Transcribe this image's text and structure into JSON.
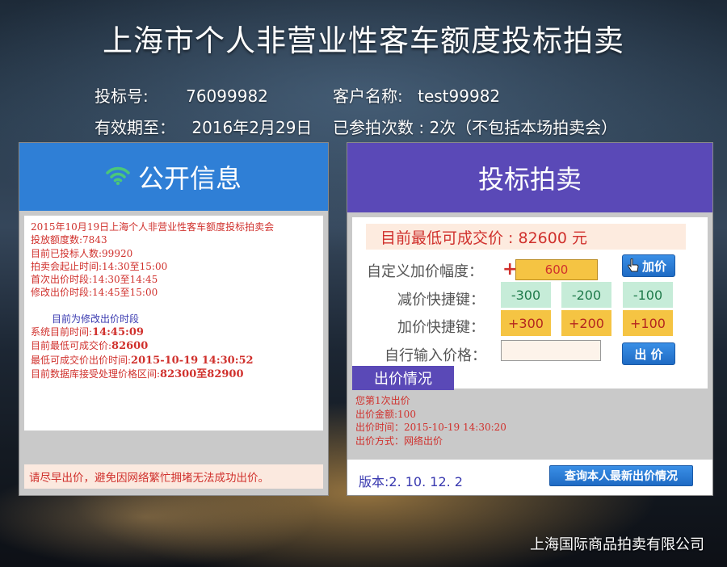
{
  "page": {
    "title": "上海市个人非营业性客车额度投标拍卖",
    "company": "上海国际商品拍卖有限公司"
  },
  "user_info": {
    "bid_no_label": "投标号:",
    "bid_no": "76099982",
    "customer_label": "客户名称:",
    "customer": "test99982",
    "valid_label": "有效期至：",
    "valid_until": "2016年2月29日",
    "attended_label": "已参拍次数 : 2次（不包括本场拍卖会）"
  },
  "public_info": {
    "header": "公开信息",
    "lines": [
      "2015年10月19日上海个人非营业性客车额度投标拍卖会",
      "投放额度数:7843",
      "目前已投标人数:99920",
      "拍卖会起止时间:14:30至15:00",
      "首次出价时段:14:30至14:45",
      "修改出价时段:14:45至15:00"
    ],
    "phase": "目前为修改出价时段",
    "system_time_label": "系统目前时间:",
    "system_time": "14:45:09",
    "lowest_price_label": "目前最低可成交价:",
    "lowest_price": "82600",
    "lowest_time_label": "最低可成交价出价时间:",
    "lowest_time": "2015-10-19 14:30:52",
    "range_label": "目前数据库接受处理价格区间:",
    "range": "82300至82900",
    "warning": "请尽早出价，避免因网络繁忙拥堵无法成功出价。"
  },
  "bidding": {
    "header": "投标拍卖",
    "current_price": "目前最低可成交价 : 82600 元",
    "custom_label": "自定义加价幅度：",
    "plus_sign": "+",
    "custom_value": "600",
    "add_button": "加价",
    "minus_label": "减价快捷键：",
    "minus_buttons": [
      "-300",
      "-200",
      "-100"
    ],
    "plus_label": "加价快捷键：",
    "plus_buttons": [
      "+300",
      "+200",
      "+100"
    ],
    "manual_label": "自行输入价格：",
    "submit_button": "出 价",
    "bid_status_tab": "出价情况",
    "bid_status_lines": [
      "您第1次出价",
      "出价金额:100",
      "出价时间：2015-10-19 14:30:20",
      "出价方式：网络出价"
    ],
    "version": "版本:2. 10. 12. 2",
    "query_button": "查询本人最新出价情况"
  },
  "colors": {
    "left_header": "#2f7fd6",
    "right_header": "#5a49b7",
    "accent_red": "#d0312d",
    "wifi_green": "#4bc77a"
  }
}
